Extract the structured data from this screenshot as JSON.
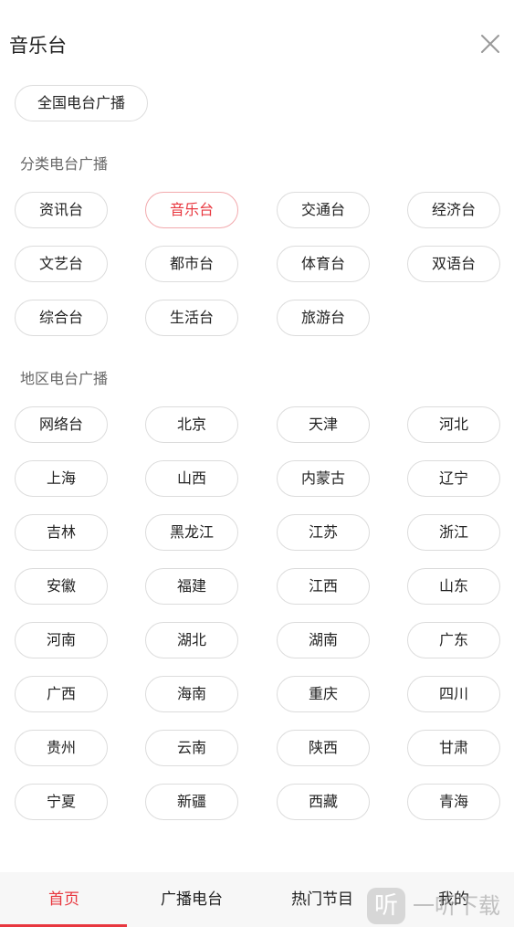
{
  "header": {
    "title": "音乐台",
    "close_icon": "close-icon"
  },
  "national": {
    "label": "全国电台广播"
  },
  "categories": {
    "title": "分类电台广播",
    "selected": "音乐台",
    "items": [
      "资讯台",
      "音乐台",
      "交通台",
      "经济台",
      "文艺台",
      "都市台",
      "体育台",
      "双语台",
      "综合台",
      "生活台",
      "旅游台"
    ]
  },
  "regions": {
    "title": "地区电台广播",
    "items": [
      "网络台",
      "北京",
      "天津",
      "河北",
      "上海",
      "山西",
      "内蒙古",
      "辽宁",
      "吉林",
      "黑龙江",
      "江苏",
      "浙江",
      "安徽",
      "福建",
      "江西",
      "山东",
      "河南",
      "湖北",
      "湖南",
      "广东",
      "广西",
      "海南",
      "重庆",
      "四川",
      "贵州",
      "云南",
      "陕西",
      "甘肃",
      "宁夏",
      "新疆",
      "西藏",
      "青海"
    ]
  },
  "bottom_nav": {
    "active": "首页",
    "items": [
      "首页",
      "广播电台",
      "热门节目",
      "我的"
    ]
  },
  "watermark": {
    "logo_char": "听",
    "text": "一听下载"
  },
  "colors": {
    "accent": "#e8373f",
    "active_chip_border": "#f2a9ad",
    "chip_border": "#dcdcdc",
    "section_title": "#666666",
    "nav_background": "#f7f7f7"
  }
}
